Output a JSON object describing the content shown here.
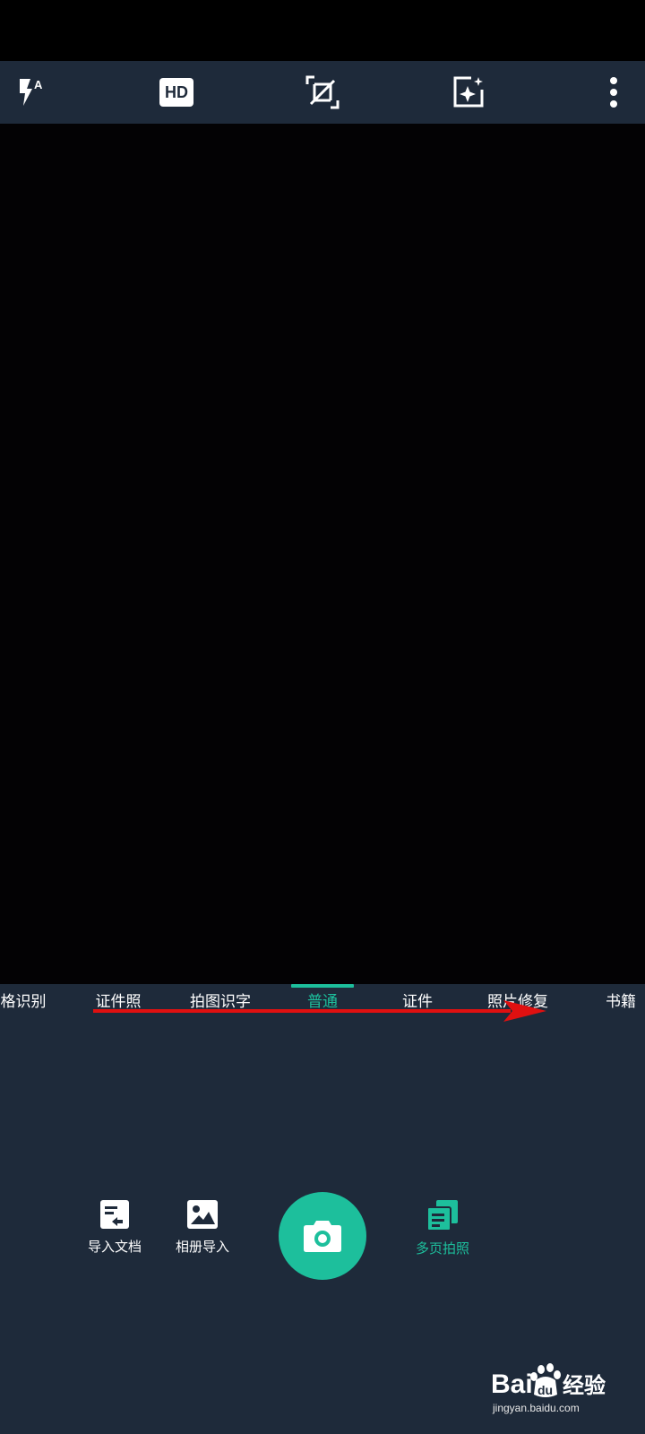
{
  "toolbar": {
    "icons": [
      "flash-auto-icon",
      "hd-icon",
      "no-crop-icon",
      "auto-enhance-icon",
      "more-vert-icon"
    ],
    "hd_label": "HD"
  },
  "modes": {
    "items": [
      "格识别",
      "证件照",
      "拍图识字",
      "普通",
      "证件",
      "照片修复",
      "书籍"
    ],
    "active": "普通"
  },
  "actions": {
    "import_doc": "导入文档",
    "album_import": "相册导入",
    "multi_page": "多页拍照"
  },
  "watermark": {
    "logo": "Bai du 经验",
    "url": "jingyan.baidu.com"
  },
  "colors": {
    "accent": "#1dbf9c",
    "panel": "#1e2a3a",
    "arrow": "#e01010"
  }
}
